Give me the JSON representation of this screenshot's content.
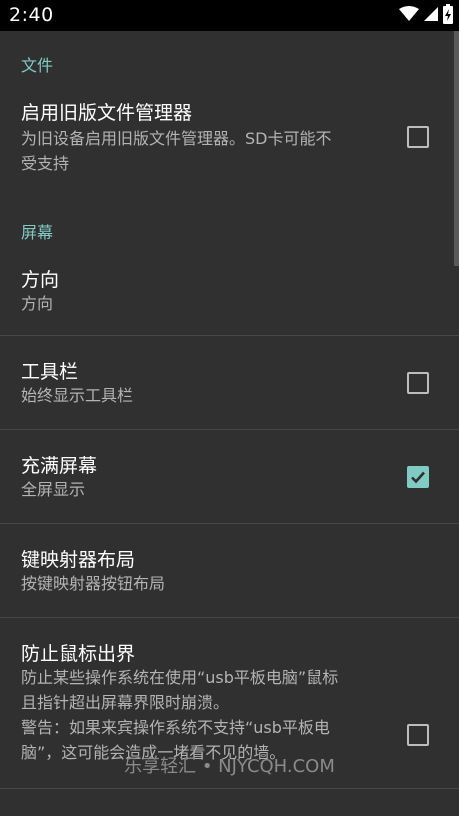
{
  "status_bar": {
    "time": "2:40",
    "icons": [
      "wifi-icon",
      "signal-icon",
      "battery-charging-icon"
    ]
  },
  "sections": {
    "file": {
      "header": "文件",
      "legacy_file_manager": {
        "title": "启用旧版文件管理器",
        "summary_line1": "为旧设备启用旧版文件管理器。SD卡可能不",
        "summary_line2": "受支持",
        "checked": false
      }
    },
    "screen": {
      "header": "屏幕",
      "orientation": {
        "title": "方向",
        "summary": "方向"
      },
      "toolbar": {
        "title": "工具栏",
        "summary": "始终显示工具栏",
        "checked": false
      },
      "fullscreen": {
        "title": "充满屏幕",
        "summary": "全屏显示",
        "checked": true
      },
      "key_mapper": {
        "title": "键映射器布局",
        "summary": "按键映射器按钮布局"
      },
      "mouse_boundary": {
        "title": "防止鼠标出界",
        "summary_line1": "防止某些操作系统在使用“usb平板电脑”鼠标",
        "summary_line2": "且指针超出屏幕界限时崩溃。",
        "summary_line3": "警告：如果来宾操作系统不支持“usb平板电",
        "summary_line4": "脑”，这可能会造成一堵看不见的墙。",
        "checked": false
      }
    }
  },
  "watermark": "乐享轻汇 • NJYCQH.COM",
  "colors": {
    "accent": "#80cbc4",
    "background": "#303030",
    "status_bar": "#000000",
    "divider": "#474747"
  }
}
